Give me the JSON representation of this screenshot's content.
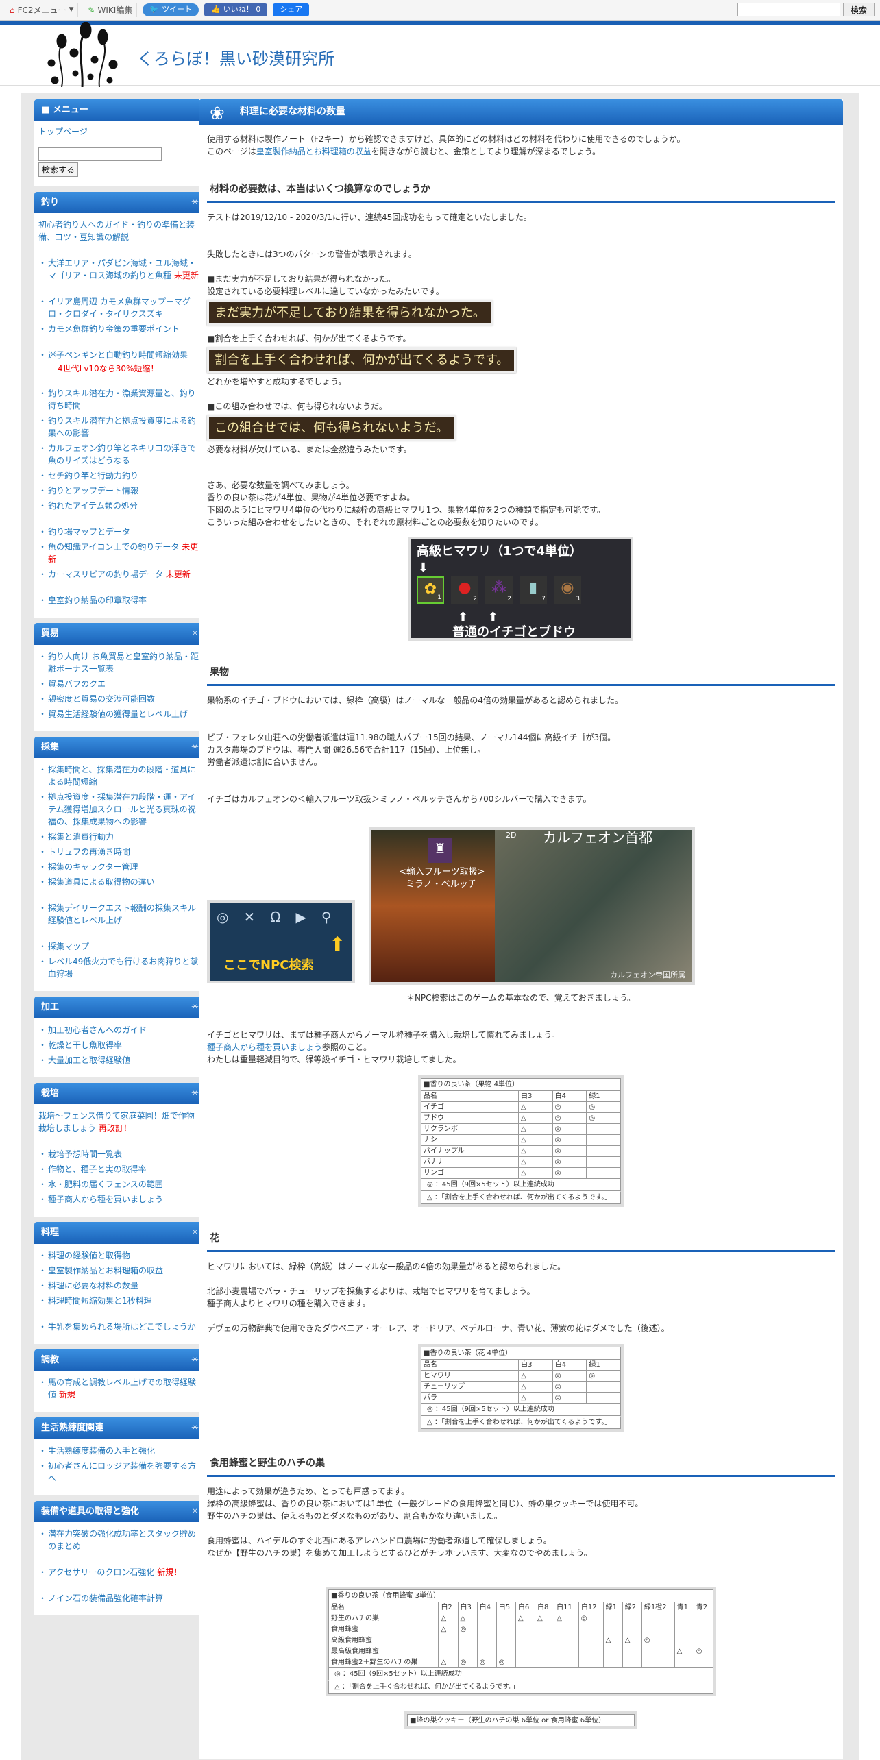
{
  "topbar": {
    "fc2_menu": "FC2メニュー",
    "wiki_edit": "WIKI編集",
    "tweet": "ツイート",
    "like": "いいね！ 0",
    "share": "シェア",
    "search_button": "検索"
  },
  "header": {
    "site_title": "くろらぼ！黒い砂漠研究所"
  },
  "sidebar": {
    "menu_title": "メニュー",
    "top_page": "トップページ",
    "search_button": "検索する",
    "sections": [
      {
        "title": "釣り",
        "items": [
          {
            "text": "初心者釣り人へのガイド・釣りの準備と装備、コツ・豆知識の解説",
            "plain": true
          },
          {
            "text": "大洋エリア・パダピン海域・ユル海域・マゴリア・ロス海域の釣りと魚種",
            "badge": "未更新",
            "gap": true
          },
          {
            "text": "イリア島周辺 カモメ魚群マップ－マグロ・クロダイ・タイリクスズキ",
            "gap": true
          },
          {
            "text": "カモメ魚群釣り金策の重要ポイント"
          },
          {
            "text": "迷子ペンギンと自動釣り時間短縮効果",
            "gap": true
          },
          {
            "note": "4世代Lv10なら30%短縮！"
          },
          {
            "text": "釣りスキル潜在力・漁業資源量と、釣り待ち時間",
            "gap": true
          },
          {
            "text": "釣りスキル潜在力と拠点投資度による釣果への影響"
          },
          {
            "text": "カルフェオン釣り竿とネキリコの浮きで魚のサイズはどうなる"
          },
          {
            "text": "セチ釣り竿と行動力釣り"
          },
          {
            "text": "釣りとアップデート情報"
          },
          {
            "text": "釣れたアイテム類の処分"
          },
          {
            "text": "釣り場マップとデータ",
            "gap": true
          },
          {
            "text": "魚の知識アイコン上での釣りデータ",
            "badge": "未更新"
          },
          {
            "text": "カーマスリビアの釣り場データ",
            "badge": "未更新"
          },
          {
            "text": "皇室釣り納品の印章取得率",
            "gap": true
          }
        ]
      },
      {
        "title": "貿易",
        "items": [
          {
            "text": "釣り人向け お魚貿易と皇室釣り納品・距離ボーナス一覧表"
          },
          {
            "text": "貿易バフのクエ"
          },
          {
            "text": "親密度と貿易の交渉可能回数"
          },
          {
            "text": "貿易生活経験値の獲得量とレベル上げ"
          }
        ]
      },
      {
        "title": "採集",
        "items": [
          {
            "text": "採集時間と、採集潜在力の段階・道具による時間短縮"
          },
          {
            "text": "拠点投資度・採集潜在力段階・運・アイテム獲得増加スクロールと光る真珠の祝福の、採集成果物への影響"
          },
          {
            "text": "採集と消費行動力"
          },
          {
            "text": "トリュフの再湧き時間"
          },
          {
            "text": "採集のキャラクター管理"
          },
          {
            "text": "採集道具による取得物の違い"
          },
          {
            "text": "採集デイリークエスト報酬の採集スキル経験値とレベル上げ",
            "gap": true
          },
          {
            "text": "採集マップ",
            "gap": true
          },
          {
            "text": "レベル49低火力でも行けるお肉狩りと献血狩場"
          }
        ]
      },
      {
        "title": "加工",
        "items": [
          {
            "text": "加工初心者さんへのガイド"
          },
          {
            "text": "乾燥と干し魚取得率"
          },
          {
            "text": "大量加工と取得経験値"
          }
        ]
      },
      {
        "title": "栽培",
        "items": [
          {
            "text": "栽培～フェンス借りて家庭菜園！畑で作物栽培しましょう",
            "badge": "再改訂！",
            "plain": true
          },
          {
            "text": "栽培予想時間一覧表",
            "gap": true
          },
          {
            "text": "作物と、種子と実の取得率"
          },
          {
            "text": "水・肥料の届くフェンスの範囲"
          },
          {
            "text": "種子商人から種を買いましょう"
          }
        ]
      },
      {
        "title": "料理",
        "items": [
          {
            "text": "料理の経験値と取得物"
          },
          {
            "text": "皇室製作納品とお料理箱の収益"
          },
          {
            "text": "料理に必要な材料の数量"
          },
          {
            "text": "料理時間短縮効果と1秒料理"
          },
          {
            "text": "牛乳を集められる場所はどこでしょうか",
            "gap": true
          }
        ]
      },
      {
        "title": "調教",
        "items": [
          {
            "text": "馬の育成と調教レベル上げでの取得経験値",
            "badge": "新規"
          }
        ]
      },
      {
        "title": "生活熟練度関連",
        "items": [
          {
            "text": "生活熟練度装備の入手と強化"
          },
          {
            "text": "初心者さんにロッジア装備を強要する方へ"
          }
        ]
      },
      {
        "title": "装備や道具の取得と強化",
        "items": [
          {
            "text": "潜在力突破の強化成功率とスタック貯めのまとめ"
          },
          {
            "text": "アクセサリーのクロン石強化",
            "badge": "新規！",
            "gap": true
          },
          {
            "text": "ノイン石の装備品強化確率計算",
            "gap": true
          }
        ]
      }
    ]
  },
  "main": {
    "title": "料理に必要な材料の数量",
    "intro1": "使用する材料は製作ノート（F2キー）から確認できますけど、具体的にどの材料はどの材料を代わりに使用できるのでしょうか。",
    "intro2_link": "皇室製作納品とお料理箱の収益",
    "intro2_pre": "このページは",
    "intro2_post": "を開きながら読むと、金策としてより理解が深まるでしょう。",
    "s1_title": "材料の必要数は、本当はいくつ換算なのでしょうか",
    "s1_p1": "テストは2019/12/10 - 2020/3/1に行い、連続45回成功をもって確定といたしました。",
    "s1_p2": "失敗したときには3つのパターンの警告が表示されます。",
    "s1_p3a": "■まだ実力が不足しており結果が得られなかった。",
    "s1_p3b": "設定されている必要料理レベルに達していなかったみたいです。",
    "s1_g1": "まだ実力が不足しており結果を得られなかった。",
    "s1_p4": "■割合を上手く合わせれば、何かが出てくるようです。",
    "s1_g2": "割合を上手く合わせれば、何かが出てくるようです。",
    "s1_p5": "どれかを増やすと成功するでしょう。",
    "s1_p6": "■この組み合わせでは、何も得られないようだ。",
    "s1_g3": "この組合せでは、何も得られないようだ。",
    "s1_p7": "必要な材料が欠けている、または全然違うみたいです。",
    "s1_p8": "さあ、必要な数量を調べてみましょう。",
    "s1_p9": "香りの良い茶は花が4単位、果物が4単位必要ですよね。",
    "s1_p10": "下図のようにヒマワリ4単位の代わりに緑枠の高級ヒマワリ1つ、果物4単位を2つの種類で指定も可能です。",
    "s1_p11": "こういった組み合わせをしたいときの、それぞれの原材料ごとの必要数を知りたいのです。",
    "img1_top": "高級ヒマワリ（1つで4単位）",
    "img1_bottom": "普通のイチゴとブドウ",
    "img1_counts": [
      "1",
      "2",
      "2",
      "7",
      "3"
    ],
    "s2_title": "果物",
    "s2_p1": "果物系のイチゴ・ブドウにおいては、緑枠（高級）はノーマルな一般品の4倍の効果量があると認められました。",
    "s2_p2": "ビブ・フォレタ山荘への労働者派遣は運11.98の職人パプー15回の結果、ノーマル144個に高級イチゴが3個。",
    "s2_p3": "カスタ農場のブドウは、専門人間 運26.56で合計117（15回）、上位無し。",
    "s2_p4": "労働者派遣は割に合いません。",
    "s2_p5": "イチゴはカルフェオンの＜輸入フルーツ取扱＞ミラノ・ベルッチさんから700シルバーで購入できます。",
    "img2_text": "ここでNPC検索",
    "img3_npc1": "<輸入フルーツ取扱>",
    "img3_npc2": "ミラノ・ベルッチ",
    "img3_map": "カルフェオン首都",
    "img3_map_small": "カルフェオン帝国所属",
    "img3_2d": "2D",
    "s2_caption": "＊NPC検索はこのゲームの基本なので、覚えておきましょう。",
    "s2_p6": "イチゴとヒマワリは、まずは種子商人からノーマル枠種子を購入し栽培して慣れてみましょう。",
    "s2_p7_link": "種子商人から種を買いましょう",
    "s2_p7_post": "参照のこと。",
    "s2_p8": "わたしは重量軽減目的で、緑等級イチゴ・ヒマワリ栽培してました。",
    "t1": {
      "title": "■香りの良い茶（果物 4単位）",
      "head": [
        "品名",
        "白3",
        "白4",
        "緑1"
      ],
      "rows": [
        [
          "イチゴ",
          "△",
          "◎",
          "◎"
        ],
        [
          "ブドウ",
          "△",
          "◎",
          "◎"
        ],
        [
          "サクランボ",
          "△",
          "◎",
          ""
        ],
        [
          "ナシ",
          "△",
          "◎",
          ""
        ],
        [
          "パイナップル",
          "△",
          "◎",
          ""
        ],
        [
          "バナナ",
          "△",
          "◎",
          ""
        ],
        [
          "リンゴ",
          "△",
          "◎",
          ""
        ]
      ],
      "note1": "◎ ：45回（9回×5セット）以上連続成功",
      "note2": "△ ：「割合を上手く合わせれば、何かが出てくるようです。」"
    },
    "s3_title": "花",
    "s3_p1": "ヒマワリにおいては、緑枠（高級）はノーマルな一般品の4倍の効果量があると認められました。",
    "s3_p2": "北部小麦農場でバラ・チューリップを採集するよりは、栽培でヒマワリを育てましょう。",
    "s3_p3": "種子商人よりヒマワリの種を購入できます。",
    "s3_p4": "デヴェの万物辞典で使用できたダウベニア・オーレア、オードリア、ベデルローナ、青い花、薄紫の花はダメでした（後述）。",
    "t2": {
      "title": "■香りの良い茶（花 4単位）",
      "head": [
        "品名",
        "白3",
        "白4",
        "緑1"
      ],
      "rows": [
        [
          "ヒマワリ",
          "△",
          "◎",
          "◎"
        ],
        [
          "チューリップ",
          "△",
          "◎",
          ""
        ],
        [
          "バラ",
          "△",
          "◎",
          ""
        ]
      ],
      "note1": "◎ ：45回（9回×5セット）以上連続成功",
      "note2": "△ ：「割合を上手く合わせれば、何かが出てくるようです。」"
    },
    "s4_title": "食用蜂蜜と野生のハチの巣",
    "s4_p1": "用途によって効果が違うため、とっても戸惑ってます。",
    "s4_p2": "緑枠の高級蜂蜜は、香りの良い茶においては1単位（一般グレードの食用蜂蜜と同じ）、蜂の巣クッキーでは使用不可。",
    "s4_p3": "野生のハチの巣は、使えるものとダメなものがあり、割合もかなり違いました。",
    "s4_p4": "食用蜂蜜は、ハイデルのすぐ北西にあるアレハンドロ農場に労働者派遣して確保しましょう。",
    "s4_p5": "なぜか【野生のハチの巣】を集めて加工しようとするひとがチラホラいます、大変なのでやめましょう。",
    "t3": {
      "title": "■香りの良い茶（食用蜂蜜 3単位）",
      "head": [
        "品名",
        "白2",
        "白3",
        "白4",
        "白5",
        "白6",
        "白8",
        "白11",
        "白12",
        "緑1",
        "緑2",
        "緑1橙2",
        "青1",
        "青2"
      ],
      "rows": [
        [
          "野生のハチの巣",
          "△",
          "△",
          "",
          "",
          "△",
          "△",
          "△",
          "◎",
          "",
          "",
          "",
          "",
          ""
        ],
        [
          "食用蜂蜜",
          "△",
          "◎",
          "",
          "",
          "",
          "",
          "",
          "",
          "",
          "",
          "",
          "",
          ""
        ],
        [
          "高級食用蜂蜜",
          "",
          "",
          "",
          "",
          "",
          "",
          "",
          "",
          "△",
          "△",
          "◎",
          "",
          ""
        ],
        [
          "最高級食用蜂蜜",
          "",
          "",
          "",
          "",
          "",
          "",
          "",
          "",
          "",
          "",
          "",
          "△",
          "◎"
        ],
        [
          "食用蜂蜜2＋野生のハチの巣",
          "△",
          "◎",
          "◎",
          "◎",
          "",
          "",
          "",
          "",
          "",
          "",
          "",
          "",
          ""
        ]
      ],
      "note1": "◎ ：45回（9回×5セット）以上連続成功",
      "note2": "△ ：「割合を上手く合わせれば、何かが出てくるようです。」"
    },
    "t4_title": "■蜂の巣クッキー（野生のハチの巣 6単位 or 食用蜂蜜 6単位）"
  }
}
